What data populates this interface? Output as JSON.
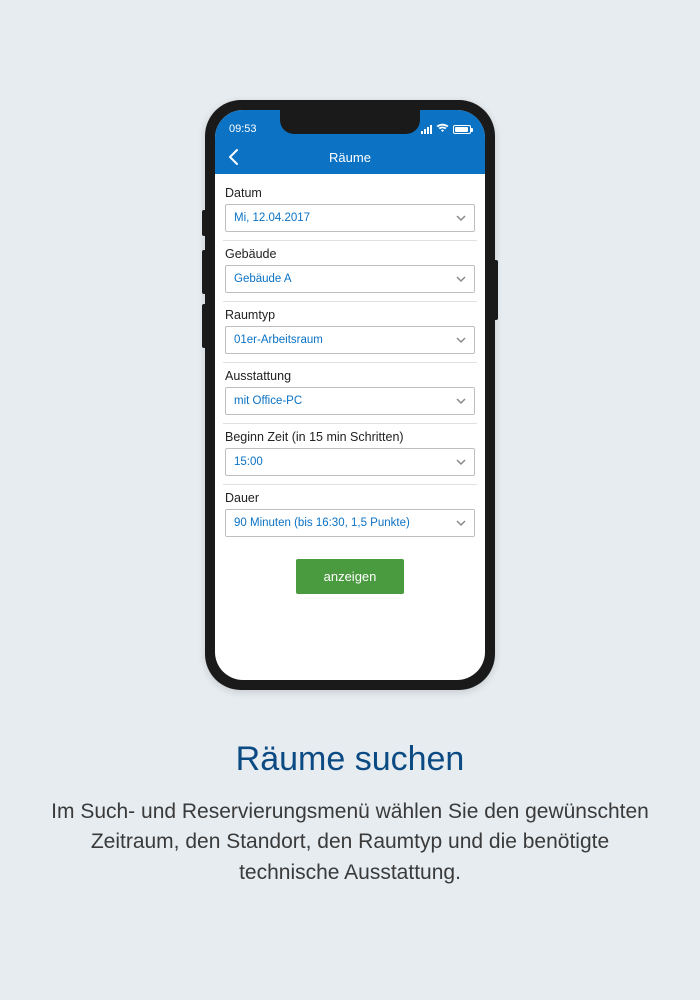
{
  "status": {
    "time": "09:53"
  },
  "nav": {
    "title": "Räume"
  },
  "fields": {
    "date": {
      "label": "Datum",
      "value": "Mi, 12.04.2017"
    },
    "building": {
      "label": "Gebäude",
      "value": "Gebäude A"
    },
    "roomtype": {
      "label": "Raumtyp",
      "value": "01er-Arbeitsraum"
    },
    "equip": {
      "label": "Ausstattung",
      "value": "mit Office-PC"
    },
    "start": {
      "label": "Beginn Zeit (in 15 min Schritten)",
      "value": "15:00"
    },
    "duration": {
      "label": "Dauer",
      "value": "90 Minuten (bis 16:30, 1,5 Punkte)"
    }
  },
  "submit": {
    "label": "anzeigen"
  },
  "caption": {
    "title": "Räume suchen",
    "body": "Im Such- und Reservierungsmenü wählen Sie den gewünschten Zeitraum, den Standort, den Raumtyp und die benötigte technische Ausstattung."
  }
}
